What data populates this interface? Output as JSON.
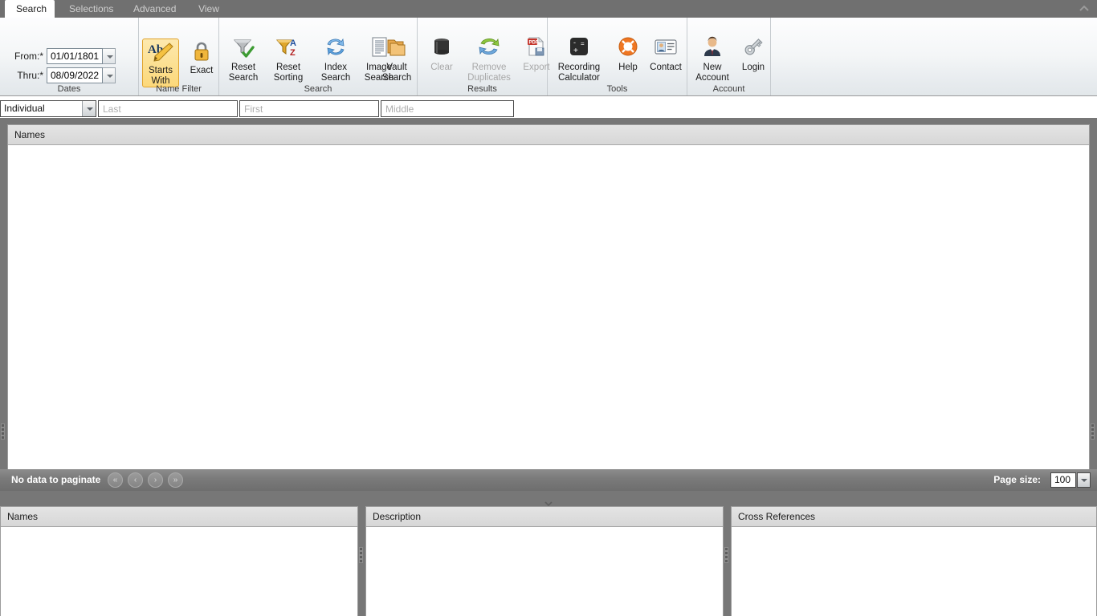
{
  "window": {
    "collapse_ribbon_icon": "chevron-up-icon"
  },
  "tabs": [
    {
      "label": "Search",
      "active": true
    },
    {
      "label": "Selections",
      "active": false
    },
    {
      "label": "Advanced",
      "active": false
    },
    {
      "label": "View",
      "active": false
    }
  ],
  "ribbon": {
    "groups": [
      {
        "label": "Dates"
      },
      {
        "label": "Name Filter"
      },
      {
        "label": "Search"
      },
      {
        "label": "Results"
      },
      {
        "label": "Tools"
      },
      {
        "label": "Account"
      }
    ],
    "dates": {
      "from_label": "From:*",
      "from_value": "01/01/1801",
      "thru_label": "Thru:*",
      "thru_value": "08/09/2022",
      "spinner_icon": "chevron-down-icon"
    },
    "name_filter": {
      "starts_with": {
        "line1": "Starts",
        "line2": "With",
        "icon": "ab-pencil-icon",
        "selected": true
      },
      "exact": {
        "line1": "Exact",
        "line2": "",
        "icon": "padlock-icon",
        "selected": false
      }
    },
    "search": {
      "reset_search": {
        "line1": "Reset",
        "line2": "Search",
        "icon": "funnel-check-icon"
      },
      "reset_sorting": {
        "line1": "Reset",
        "line2": "Sorting",
        "icon": "funnel-az-icon"
      },
      "index_search": {
        "line1": "Index",
        "line2": "Search",
        "icon": "refresh-arrows-icon"
      },
      "image_search": {
        "line1": "Image",
        "line2": "Search",
        "icon": "document-lines-icon"
      },
      "vault_search": {
        "line1": "Vault",
        "line2": "Search",
        "icon": "folders-icon"
      }
    },
    "results": {
      "clear": {
        "line1": "Clear",
        "line2": "",
        "icon": "trash-can-icon",
        "disabled": true
      },
      "remove_duplicates": {
        "line1": "Remove",
        "line2": "Duplicates",
        "icon": "recycle-arrows-icon",
        "disabled": true
      },
      "export": {
        "line1": "Export",
        "line2": "",
        "icon": "pdf-save-icon",
        "disabled": true
      }
    },
    "tools": {
      "recording_calculator": {
        "line1": "Recording",
        "line2": "Calculator",
        "icon": "calculator-icon"
      },
      "help": {
        "line1": "Help",
        "line2": "",
        "icon": "life-ring-icon"
      },
      "contact": {
        "line1": "Contact",
        "line2": "",
        "icon": "contact-card-icon"
      }
    },
    "account": {
      "new_account": {
        "line1": "New",
        "line2": "Account",
        "icon": "person-suit-icon"
      },
      "login": {
        "line1": "Login",
        "line2": "",
        "icon": "key-icon"
      }
    }
  },
  "search_bar": {
    "entity_type": {
      "value": "Individual",
      "arrow_icon": "chevron-down-icon"
    },
    "last": {
      "placeholder": "Last",
      "value": ""
    },
    "first": {
      "placeholder": "First",
      "value": ""
    },
    "middle": {
      "placeholder": "Middle",
      "value": ""
    }
  },
  "results_grid": {
    "column_header": "Names",
    "rows": []
  },
  "pager": {
    "status": "No data to paginate",
    "first_icon": "«",
    "prev_icon": "‹",
    "next_icon": "›",
    "last_icon": "»",
    "page_size_label": "Page size:",
    "page_size_value": "100",
    "page_size_arrow_icon": "chevron-down-icon"
  },
  "splitter": {
    "collapse_icon": "chevron-down-small-icon"
  },
  "bottom_panels": [
    {
      "header": "Names",
      "content": ""
    },
    {
      "header": "Description",
      "content": ""
    },
    {
      "header": "Cross References",
      "content": ""
    }
  ],
  "colors": {
    "chrome_gray": "#777777",
    "tabbar_gray": "#707070",
    "accent_selected": "#fcd87a",
    "header_gray": "#dcdcdc"
  }
}
